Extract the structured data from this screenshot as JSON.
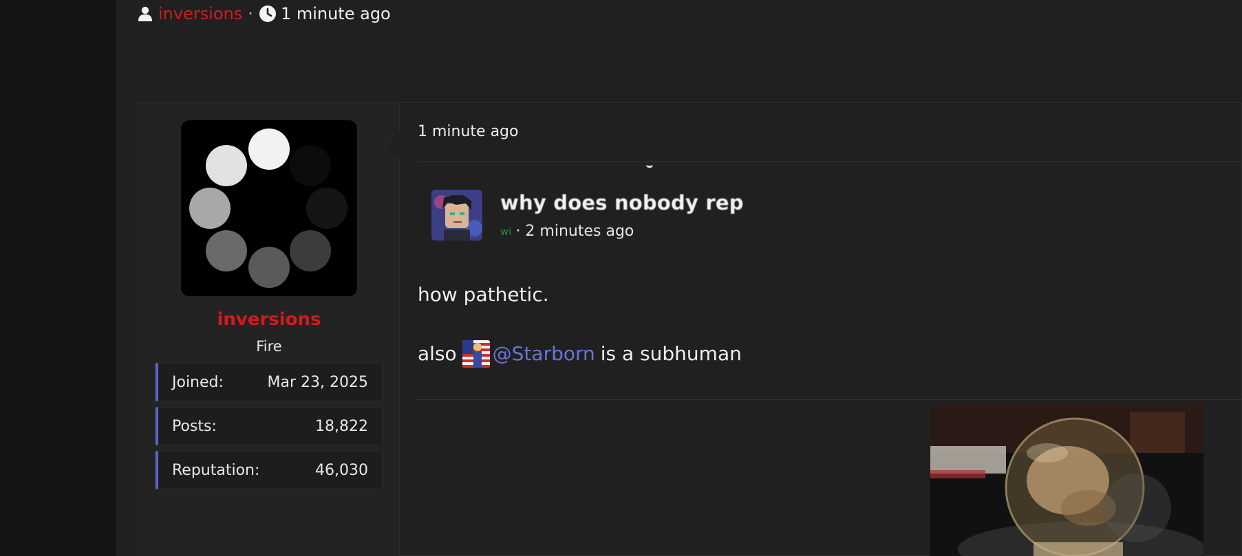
{
  "thread_meta": {
    "author": "inversions",
    "separator": "·",
    "time": "1 minute ago",
    "author_color": "#d01c1c"
  },
  "post": {
    "user": {
      "username": "inversions",
      "title": "Fire",
      "username_color": "#d01c1c",
      "stats": [
        {
          "label": "Joined:",
          "value": "Mar 23, 2025"
        },
        {
          "label": "Posts:",
          "value": "18,822"
        },
        {
          "label": "Reputation:",
          "value": "46,030"
        }
      ]
    },
    "time": "1 minute ago",
    "quote": {
      "title": "why does nobody rep",
      "author": "wi",
      "time": "· 2 minutes ago"
    },
    "body": {
      "line1": "how pathetic.",
      "line2_prefix": "also",
      "mention": "@Starborn",
      "line2_suffix": "is a subhuman"
    }
  },
  "icons": {
    "user": "user-icon",
    "clock": "clock-icon"
  },
  "colors": {
    "accent": "#5b67c9",
    "mention": "#6b74d6",
    "background": "#202020"
  }
}
